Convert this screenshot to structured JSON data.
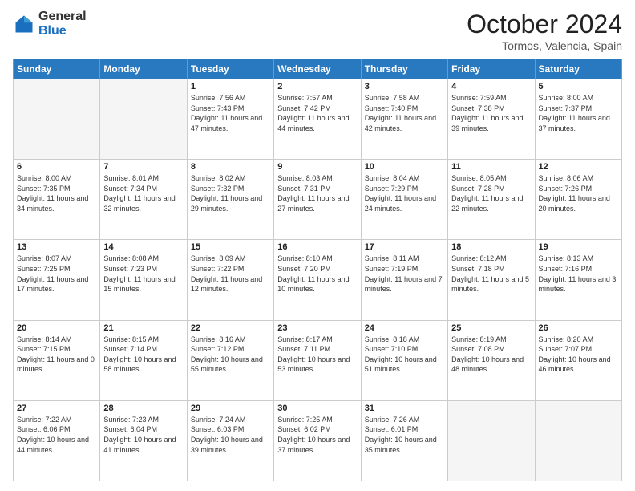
{
  "logo": {
    "general": "General",
    "blue": "Blue"
  },
  "header": {
    "month": "October 2024",
    "location": "Tormos, Valencia, Spain"
  },
  "weekdays": [
    "Sunday",
    "Monday",
    "Tuesday",
    "Wednesday",
    "Thursday",
    "Friday",
    "Saturday"
  ],
  "weeks": [
    [
      {
        "day": "",
        "sunrise": "",
        "sunset": "",
        "daylight": ""
      },
      {
        "day": "",
        "sunrise": "",
        "sunset": "",
        "daylight": ""
      },
      {
        "day": "1",
        "sunrise": "Sunrise: 7:56 AM",
        "sunset": "Sunset: 7:43 PM",
        "daylight": "Daylight: 11 hours and 47 minutes."
      },
      {
        "day": "2",
        "sunrise": "Sunrise: 7:57 AM",
        "sunset": "Sunset: 7:42 PM",
        "daylight": "Daylight: 11 hours and 44 minutes."
      },
      {
        "day": "3",
        "sunrise": "Sunrise: 7:58 AM",
        "sunset": "Sunset: 7:40 PM",
        "daylight": "Daylight: 11 hours and 42 minutes."
      },
      {
        "day": "4",
        "sunrise": "Sunrise: 7:59 AM",
        "sunset": "Sunset: 7:38 PM",
        "daylight": "Daylight: 11 hours and 39 minutes."
      },
      {
        "day": "5",
        "sunrise": "Sunrise: 8:00 AM",
        "sunset": "Sunset: 7:37 PM",
        "daylight": "Daylight: 11 hours and 37 minutes."
      }
    ],
    [
      {
        "day": "6",
        "sunrise": "Sunrise: 8:00 AM",
        "sunset": "Sunset: 7:35 PM",
        "daylight": "Daylight: 11 hours and 34 minutes."
      },
      {
        "day": "7",
        "sunrise": "Sunrise: 8:01 AM",
        "sunset": "Sunset: 7:34 PM",
        "daylight": "Daylight: 11 hours and 32 minutes."
      },
      {
        "day": "8",
        "sunrise": "Sunrise: 8:02 AM",
        "sunset": "Sunset: 7:32 PM",
        "daylight": "Daylight: 11 hours and 29 minutes."
      },
      {
        "day": "9",
        "sunrise": "Sunrise: 8:03 AM",
        "sunset": "Sunset: 7:31 PM",
        "daylight": "Daylight: 11 hours and 27 minutes."
      },
      {
        "day": "10",
        "sunrise": "Sunrise: 8:04 AM",
        "sunset": "Sunset: 7:29 PM",
        "daylight": "Daylight: 11 hours and 24 minutes."
      },
      {
        "day": "11",
        "sunrise": "Sunrise: 8:05 AM",
        "sunset": "Sunset: 7:28 PM",
        "daylight": "Daylight: 11 hours and 22 minutes."
      },
      {
        "day": "12",
        "sunrise": "Sunrise: 8:06 AM",
        "sunset": "Sunset: 7:26 PM",
        "daylight": "Daylight: 11 hours and 20 minutes."
      }
    ],
    [
      {
        "day": "13",
        "sunrise": "Sunrise: 8:07 AM",
        "sunset": "Sunset: 7:25 PM",
        "daylight": "Daylight: 11 hours and 17 minutes."
      },
      {
        "day": "14",
        "sunrise": "Sunrise: 8:08 AM",
        "sunset": "Sunset: 7:23 PM",
        "daylight": "Daylight: 11 hours and 15 minutes."
      },
      {
        "day": "15",
        "sunrise": "Sunrise: 8:09 AM",
        "sunset": "Sunset: 7:22 PM",
        "daylight": "Daylight: 11 hours and 12 minutes."
      },
      {
        "day": "16",
        "sunrise": "Sunrise: 8:10 AM",
        "sunset": "Sunset: 7:20 PM",
        "daylight": "Daylight: 11 hours and 10 minutes."
      },
      {
        "day": "17",
        "sunrise": "Sunrise: 8:11 AM",
        "sunset": "Sunset: 7:19 PM",
        "daylight": "Daylight: 11 hours and 7 minutes."
      },
      {
        "day": "18",
        "sunrise": "Sunrise: 8:12 AM",
        "sunset": "Sunset: 7:18 PM",
        "daylight": "Daylight: 11 hours and 5 minutes."
      },
      {
        "day": "19",
        "sunrise": "Sunrise: 8:13 AM",
        "sunset": "Sunset: 7:16 PM",
        "daylight": "Daylight: 11 hours and 3 minutes."
      }
    ],
    [
      {
        "day": "20",
        "sunrise": "Sunrise: 8:14 AM",
        "sunset": "Sunset: 7:15 PM",
        "daylight": "Daylight: 11 hours and 0 minutes."
      },
      {
        "day": "21",
        "sunrise": "Sunrise: 8:15 AM",
        "sunset": "Sunset: 7:14 PM",
        "daylight": "Daylight: 10 hours and 58 minutes."
      },
      {
        "day": "22",
        "sunrise": "Sunrise: 8:16 AM",
        "sunset": "Sunset: 7:12 PM",
        "daylight": "Daylight: 10 hours and 55 minutes."
      },
      {
        "day": "23",
        "sunrise": "Sunrise: 8:17 AM",
        "sunset": "Sunset: 7:11 PM",
        "daylight": "Daylight: 10 hours and 53 minutes."
      },
      {
        "day": "24",
        "sunrise": "Sunrise: 8:18 AM",
        "sunset": "Sunset: 7:10 PM",
        "daylight": "Daylight: 10 hours and 51 minutes."
      },
      {
        "day": "25",
        "sunrise": "Sunrise: 8:19 AM",
        "sunset": "Sunset: 7:08 PM",
        "daylight": "Daylight: 10 hours and 48 minutes."
      },
      {
        "day": "26",
        "sunrise": "Sunrise: 8:20 AM",
        "sunset": "Sunset: 7:07 PM",
        "daylight": "Daylight: 10 hours and 46 minutes."
      }
    ],
    [
      {
        "day": "27",
        "sunrise": "Sunrise: 7:22 AM",
        "sunset": "Sunset: 6:06 PM",
        "daylight": "Daylight: 10 hours and 44 minutes."
      },
      {
        "day": "28",
        "sunrise": "Sunrise: 7:23 AM",
        "sunset": "Sunset: 6:04 PM",
        "daylight": "Daylight: 10 hours and 41 minutes."
      },
      {
        "day": "29",
        "sunrise": "Sunrise: 7:24 AM",
        "sunset": "Sunset: 6:03 PM",
        "daylight": "Daylight: 10 hours and 39 minutes."
      },
      {
        "day": "30",
        "sunrise": "Sunrise: 7:25 AM",
        "sunset": "Sunset: 6:02 PM",
        "daylight": "Daylight: 10 hours and 37 minutes."
      },
      {
        "day": "31",
        "sunrise": "Sunrise: 7:26 AM",
        "sunset": "Sunset: 6:01 PM",
        "daylight": "Daylight: 10 hours and 35 minutes."
      },
      {
        "day": "",
        "sunrise": "",
        "sunset": "",
        "daylight": ""
      },
      {
        "day": "",
        "sunrise": "",
        "sunset": "",
        "daylight": ""
      }
    ]
  ]
}
